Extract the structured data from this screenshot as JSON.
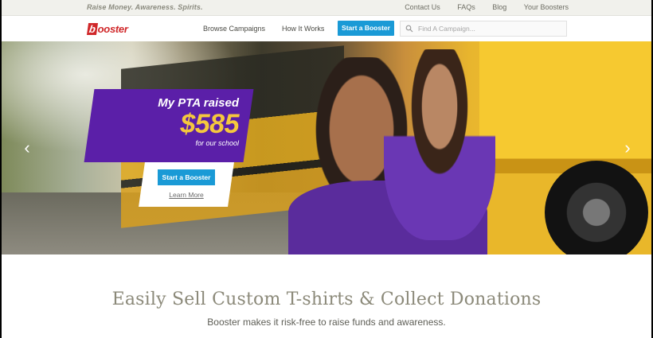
{
  "topbar": {
    "tagline": "Raise Money. Awareness. Spirits.",
    "links": [
      "Contact Us",
      "FAQs",
      "Blog",
      "Your Boosters"
    ]
  },
  "nav": {
    "logo": "Booster",
    "logo_first": "b",
    "logo_rest": "ooster",
    "browse": "Browse Campaigns",
    "how": "How It Works",
    "cta": "Start a Booster",
    "search_placeholder": "Find A Campaign..."
  },
  "hero": {
    "promo_title": "My PTA raised",
    "promo_amount": "$585",
    "promo_sub": "for our school",
    "cta": "Start a Booster",
    "learn_more": "Learn More",
    "arrow_prev": "‹",
    "arrow_next": "›"
  },
  "main": {
    "headline": "Easily Sell Custom T-shirts & Collect Donations",
    "subheadline": "Booster makes it risk-free to raise funds and awareness."
  },
  "colors": {
    "accent_blue": "#1a9ad6",
    "brand_red": "#d0282a",
    "promo_purple": "#5b1fa8",
    "promo_gold": "#f5c83d"
  }
}
